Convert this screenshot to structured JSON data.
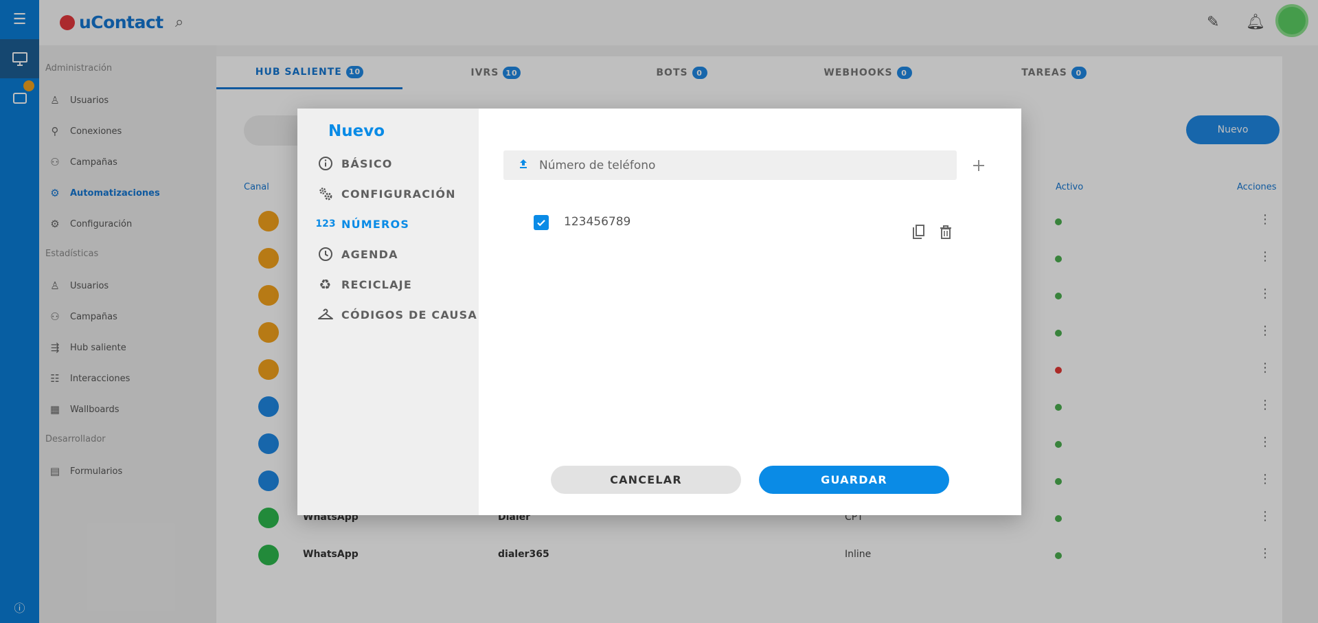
{
  "app": {
    "logo_text": "uContact",
    "menu_icon": "menu-icon",
    "search_icon": "search-icon"
  },
  "sidebar": {
    "sections": [
      {
        "label": "Administración"
      },
      {
        "label": "Estadísticas"
      },
      {
        "label": "Desarrollador"
      }
    ],
    "items": [
      {
        "label": "Usuarios",
        "icon": "user-icon"
      },
      {
        "label": "Conexiones",
        "icon": "link-icon"
      },
      {
        "label": "Campañas",
        "icon": "campaign-icon"
      },
      {
        "label": "Automatizaciones",
        "icon": "automation-icon",
        "active": true
      },
      {
        "label": "Configuración",
        "icon": "gear-icon"
      },
      {
        "label": "Usuarios",
        "icon": "user-icon"
      },
      {
        "label": "Campañas",
        "icon": "campaign-icon"
      },
      {
        "label": "Hub saliente",
        "icon": "hub-icon"
      },
      {
        "label": "Interacciones",
        "icon": "chat-icon"
      },
      {
        "label": "Wallboards",
        "icon": "chart-icon"
      },
      {
        "label": "Formularios",
        "icon": "form-icon"
      }
    ]
  },
  "tabs": [
    {
      "label": "HUB SALIENTE",
      "count": "10",
      "active": true
    },
    {
      "label": "IVRS",
      "count": "10"
    },
    {
      "label": "BOTS",
      "count": "0"
    },
    {
      "label": "WEBHOOKS",
      "count": "0"
    },
    {
      "label": "TAREAS",
      "count": "0"
    }
  ],
  "list": {
    "new_button": "Nuevo",
    "headers": {
      "col1": "Canal",
      "status": "Activo",
      "actions": "Acciones"
    },
    "rows": [
      {
        "color": "#f4a31d",
        "c1": "",
        "c2": "",
        "c3": "",
        "status": "#4caf50"
      },
      {
        "color": "#f4a31d",
        "c1": "",
        "c2": "",
        "c3": "",
        "status": "#4caf50"
      },
      {
        "color": "#f4a31d",
        "c1": "",
        "c2": "",
        "c3": "",
        "status": "#4caf50"
      },
      {
        "color": "#f4a31d",
        "c1": "",
        "c2": "",
        "c3": "",
        "status": "#4caf50"
      },
      {
        "color": "#f4a31d",
        "c1": "",
        "c2": "",
        "c3": "",
        "status": "#e53935"
      },
      {
        "color": "#1f88e5",
        "c1": "",
        "c2": "",
        "c3": "",
        "status": "#4caf50"
      },
      {
        "color": "#1f88e5",
        "c1": "",
        "c2": "",
        "c3": "",
        "status": "#4caf50"
      },
      {
        "color": "#1f88e5",
        "c1": "",
        "c2": "",
        "c3": "",
        "status": "#4caf50"
      },
      {
        "color": "#2eb84e",
        "c1": "WhatsApp",
        "c2": "Dialer",
        "c3": "CPT",
        "status": "#4caf50"
      },
      {
        "color": "#2eb84e",
        "c1": "WhatsApp",
        "c2": "dialer365",
        "c3": "Inline",
        "status": "#4caf50"
      }
    ]
  },
  "modal": {
    "title": "Nuevo",
    "nav": [
      {
        "label": "BÁSICO",
        "icon": "info-icon"
      },
      {
        "label": "CONFIGURACIÓN",
        "icon": "gears-icon"
      },
      {
        "label": "NÚMEROS",
        "icon": "numbers-icon",
        "icon_text": "123",
        "active": true
      },
      {
        "label": "AGENDA",
        "icon": "clock-icon"
      },
      {
        "label": "RECICLAJE",
        "icon": "recycle-icon"
      },
      {
        "label": "CÓDIGOS DE CAUSA",
        "icon": "hanger-icon"
      }
    ],
    "phone_input": {
      "placeholder": "Número de teléfono",
      "value": ""
    },
    "numbers": [
      {
        "value": "123456789",
        "checked": true
      }
    ],
    "cancel_label": "CANCELAR",
    "save_label": "GUARDAR",
    "accent": "#0a8be6"
  }
}
